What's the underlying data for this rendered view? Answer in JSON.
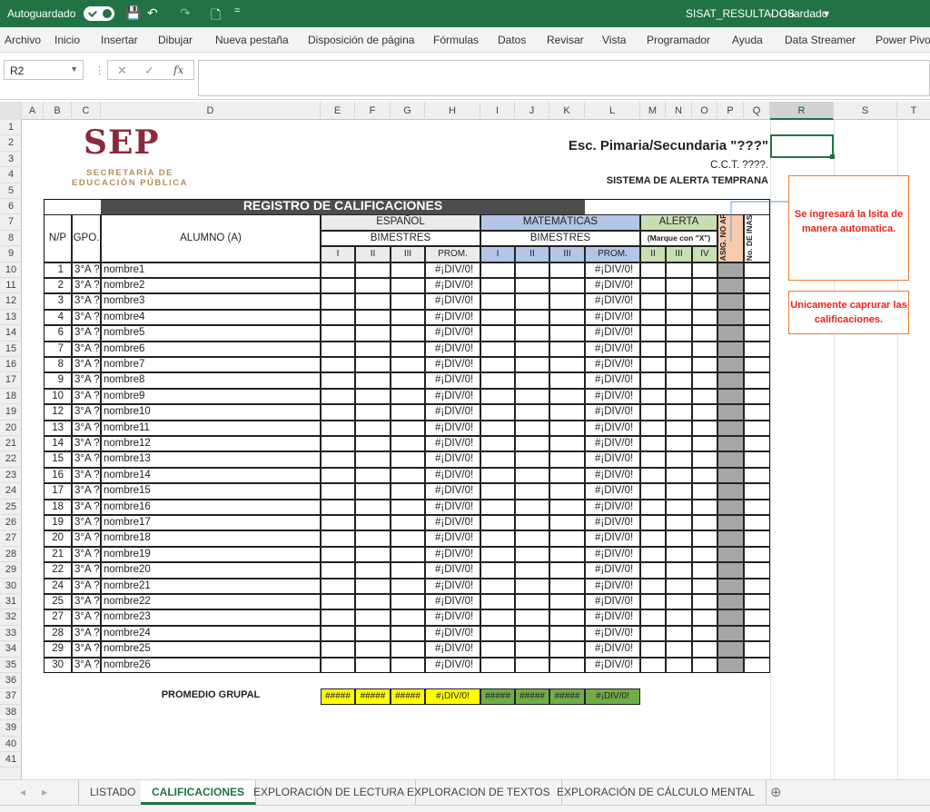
{
  "titlebar": {
    "autosave_label": "Autoguardado",
    "doc_title": "SISAT_RESULTADOS",
    "save_status": "Guardado",
    "status_sep": "-",
    "chevron": "▾",
    "undo_icon": "↶",
    "redo_icon": "↷",
    "save_icon": "💾",
    "new_icon": "🗋",
    "qat_dropdown": "="
  },
  "menu": [
    "Archivo",
    "Inicio",
    "Insertar",
    "Dibujar",
    "Nueva pestaña",
    "Disposición de página",
    "Fórmulas",
    "Datos",
    "Revisar",
    "Vista",
    "Programador",
    "Ayuda",
    "Data Streamer",
    "Power Pivot"
  ],
  "formula_bar": {
    "cell_ref": "R2",
    "cancel": "✕",
    "enter": "✓",
    "fx": "fx",
    "formula": ""
  },
  "columns": [
    "A",
    "B",
    "C",
    "D",
    "E",
    "F",
    "G",
    "H",
    "I",
    "J",
    "K",
    "L",
    "M",
    "N",
    "O",
    "P",
    "Q",
    "R",
    "S",
    "T"
  ],
  "rows": [
    "1",
    "2",
    "3",
    "4",
    "5",
    "6",
    "7",
    "8",
    "9",
    "10",
    "11",
    "12",
    "13",
    "14",
    "15",
    "16",
    "17",
    "18",
    "19",
    "20",
    "21",
    "22",
    "23",
    "24",
    "25",
    "26",
    "27",
    "28",
    "29",
    "30",
    "31",
    "32",
    "33",
    "34",
    "35",
    "36",
    "37",
    "38",
    "39",
    "40",
    "41"
  ],
  "logo": {
    "text": "SEP",
    "sub1": "SECRETARÍA DE",
    "sub2": "EDUCACIÓN PÚBLICA"
  },
  "header": {
    "school": "Esc. Pimaria/Secundaria \"???\"",
    "cct": "C.C.T. ????.",
    "system": "SISTEMA DE ALERTA TEMPRANA"
  },
  "table": {
    "title": "REGISTRO DE CALIFICACIONES",
    "col_np": "N/P",
    "col_gpo": "GPO.",
    "col_alumno": "ALUMNO (A)",
    "espanol": "ESPAÑOL",
    "matematicas": "MATEMÁTICAS",
    "alerta": "ALERTA",
    "bimestres": "BIMESTRES",
    "marque": "(Marque con \"X\")",
    "asig": "ASIG. NO APROB.",
    "inasist": "No. DE INASIST.",
    "sub_e": [
      "I",
      "II",
      "III",
      "PROM."
    ],
    "sub_m": [
      "I",
      "II",
      "III",
      "PROM."
    ],
    "sub_a": [
      "II",
      "III",
      "IV"
    ],
    "students": [
      {
        "np": "1",
        "gpo": "3°A ?",
        "name": "nombre1",
        "pe": "#¡DIV/0!",
        "pm": "#¡DIV/0!"
      },
      {
        "np": "2",
        "gpo": "3°A ?",
        "name": "nombre2",
        "pe": "#¡DIV/0!",
        "pm": "#¡DIV/0!"
      },
      {
        "np": "3",
        "gpo": "3°A ?",
        "name": "nombre3",
        "pe": "#¡DIV/0!",
        "pm": "#¡DIV/0!"
      },
      {
        "np": "4",
        "gpo": "3°A ?",
        "name": "nombre4",
        "pe": "#¡DIV/0!",
        "pm": "#¡DIV/0!"
      },
      {
        "np": "6",
        "gpo": "3°A ?",
        "name": "nombre5",
        "pe": "#¡DIV/0!",
        "pm": "#¡DIV/0!"
      },
      {
        "np": "7",
        "gpo": "3°A ?",
        "name": "nombre6",
        "pe": "#¡DIV/0!",
        "pm": "#¡DIV/0!"
      },
      {
        "np": "8",
        "gpo": "3°A ?",
        "name": "nombre7",
        "pe": "#¡DIV/0!",
        "pm": "#¡DIV/0!"
      },
      {
        "np": "9",
        "gpo": "3°A ?",
        "name": "nombre8",
        "pe": "#¡DIV/0!",
        "pm": "#¡DIV/0!"
      },
      {
        "np": "10",
        "gpo": "3°A ?",
        "name": "nombre9",
        "pe": "#¡DIV/0!",
        "pm": "#¡DIV/0!"
      },
      {
        "np": "12",
        "gpo": "3°A ?",
        "name": "nombre10",
        "pe": "#¡DIV/0!",
        "pm": "#¡DIV/0!"
      },
      {
        "np": "13",
        "gpo": "3°A ?",
        "name": "nombre11",
        "pe": "#¡DIV/0!",
        "pm": "#¡DIV/0!"
      },
      {
        "np": "14",
        "gpo": "3°A ?",
        "name": "nombre12",
        "pe": "#¡DIV/0!",
        "pm": "#¡DIV/0!"
      },
      {
        "np": "15",
        "gpo": "3°A ?",
        "name": "nombre13",
        "pe": "#¡DIV/0!",
        "pm": "#¡DIV/0!"
      },
      {
        "np": "16",
        "gpo": "3°A ?",
        "name": "nombre14",
        "pe": "#¡DIV/0!",
        "pm": "#¡DIV/0!"
      },
      {
        "np": "17",
        "gpo": "3°A ?",
        "name": "nombre15",
        "pe": "#¡DIV/0!",
        "pm": "#¡DIV/0!"
      },
      {
        "np": "18",
        "gpo": "3°A ?",
        "name": "nombre16",
        "pe": "#¡DIV/0!",
        "pm": "#¡DIV/0!"
      },
      {
        "np": "19",
        "gpo": "3°A ?",
        "name": "nombre17",
        "pe": "#¡DIV/0!",
        "pm": "#¡DIV/0!"
      },
      {
        "np": "20",
        "gpo": "3°A ?",
        "name": "nombre18",
        "pe": "#¡DIV/0!",
        "pm": "#¡DIV/0!"
      },
      {
        "np": "21",
        "gpo": "3°A ?",
        "name": "nombre19",
        "pe": "#¡DIV/0!",
        "pm": "#¡DIV/0!"
      },
      {
        "np": "22",
        "gpo": "3°A ?",
        "name": "nombre20",
        "pe": "#¡DIV/0!",
        "pm": "#¡DIV/0!"
      },
      {
        "np": "24",
        "gpo": "3°A ?",
        "name": "nombre21",
        "pe": "#¡DIV/0!",
        "pm": "#¡DIV/0!"
      },
      {
        "np": "25",
        "gpo": "3°A ?",
        "name": "nombre22",
        "pe": "#¡DIV/0!",
        "pm": "#¡DIV/0!"
      },
      {
        "np": "27",
        "gpo": "3°A ?",
        "name": "nombre23",
        "pe": "#¡DIV/0!",
        "pm": "#¡DIV/0!"
      },
      {
        "np": "28",
        "gpo": "3°A ?",
        "name": "nombre24",
        "pe": "#¡DIV/0!",
        "pm": "#¡DIV/0!"
      },
      {
        "np": "29",
        "gpo": "3°A ?",
        "name": "nombre25",
        "pe": "#¡DIV/0!",
        "pm": "#¡DIV/0!"
      },
      {
        "np": "30",
        "gpo": "3°A ?",
        "name": "nombre26",
        "pe": "#¡DIV/0!",
        "pm": "#¡DIV/0!"
      }
    ],
    "promedio_label": "PROMEDIO GRUPAL",
    "promedio_e": [
      "#####",
      "#####",
      "#####",
      "#¡DIV/0!"
    ],
    "promedio_m": [
      "#####",
      "#####",
      "#####",
      "#¡DIV/0!"
    ]
  },
  "notes": {
    "list": "Se ingresará la lsita de manera automatica.",
    "grades": "Unicamente caprurar las calificaciones."
  },
  "tabs": {
    "nav_prev": "◂",
    "nav_next": "▸",
    "items": [
      "LISTADO",
      "CALIFICACIONES",
      "EXPLORACIÓN DE LECTURA",
      "EXPLORACION DE TEXTOS",
      "EXPLORACIÓN DE CÁLCULO MENTAL"
    ],
    "active": 1,
    "add": "⊕"
  },
  "colors": {
    "excel_green": "#217346",
    "dark_header": "#4d4d4d",
    "espanol": "#ebebeb",
    "matematicas": "#b4c6e7",
    "alerta": "#c6e0b4",
    "asig": "#f8cbad",
    "note_red": "#e8221b"
  }
}
